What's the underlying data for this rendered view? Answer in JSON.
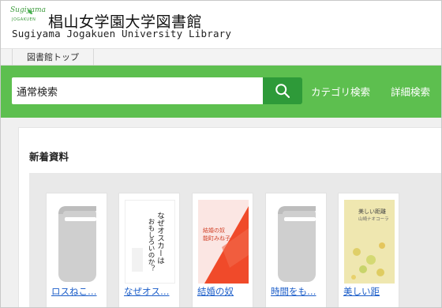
{
  "header": {
    "logo_text": "Sugiyama",
    "logo_sub": "JOGAKUEN",
    "title_jp": "椙山女学園大学図書館",
    "title_en": "Sugiyama Jogakuen University Library"
  },
  "nav": {
    "items": [
      {
        "label": "図書館トップ"
      }
    ]
  },
  "search": {
    "value": "通常検索",
    "button_icon": "search-icon",
    "links": [
      {
        "label": "カテゴリ検索"
      },
      {
        "label": "詳細検索"
      }
    ]
  },
  "section": {
    "title": "新着資料"
  },
  "books": [
    {
      "title": "ロスねこ…",
      "cover": "placeholder-book-icon"
    },
    {
      "title": "なぜオス…",
      "cover": "cover-image",
      "cover_text_main": "なぜオスカーは",
      "cover_text_sub": "おもしろいのか？"
    },
    {
      "title": "結婚の奴",
      "cover": "cover-image",
      "cover_text_main": "結婚の奴",
      "cover_text_sub": "能町みね子"
    },
    {
      "title": "時間をも…",
      "cover": "placeholder-book-icon"
    },
    {
      "title": "美しい距",
      "cover": "cover-image",
      "cover_text_main": "美しい距離",
      "cover_text_sub": "山崎ナオコーラ"
    }
  ],
  "colors": {
    "accent_green": "#5dbf4f",
    "button_green": "#2e9a39",
    "link_blue": "#1c5ec9"
  }
}
